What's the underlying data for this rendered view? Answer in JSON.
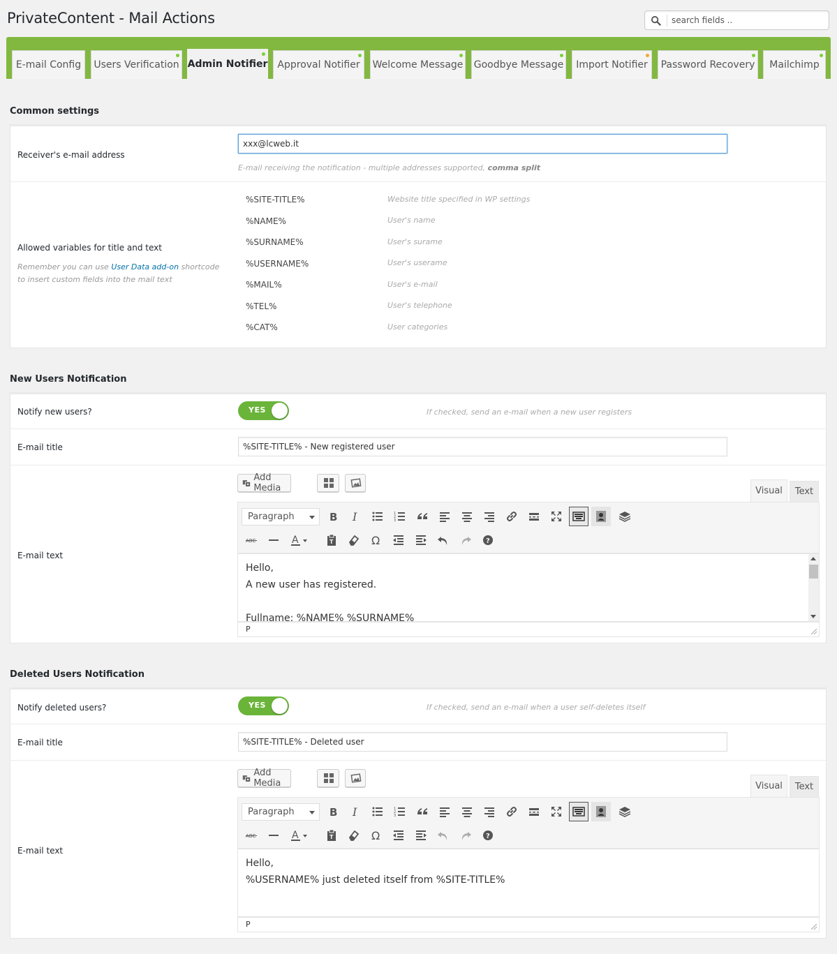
{
  "page": {
    "title": "PrivateContent - Mail Actions"
  },
  "search": {
    "placeholder": "search fields .."
  },
  "tabs": [
    {
      "label": "E-mail Config",
      "dot": ""
    },
    {
      "label": "Users Verification",
      "dot": "green"
    },
    {
      "label": "Admin Notifier",
      "dot": "green",
      "active": true
    },
    {
      "label": "Approval Notifier",
      "dot": "green"
    },
    {
      "label": "Welcome Message",
      "dot": "green"
    },
    {
      "label": "Goodbye Message",
      "dot": "green"
    },
    {
      "label": "Import Notifier",
      "dot": "orange"
    },
    {
      "label": "Password Recovery",
      "dot": "green"
    },
    {
      "label": "Mailchimp",
      "dot": "green"
    }
  ],
  "colors": {
    "accent_green": "#82b840",
    "toggle_green": "#6ab43a",
    "link_blue": "#0073aa",
    "dot_orange": "#f0a830"
  },
  "common": {
    "title": "Common settings",
    "receiver_label": "Receiver's e-mail address",
    "receiver_value": "xxx@lcweb.it",
    "receiver_hint": "E-mail receiving the notification - multiple addresses supported,",
    "receiver_hint_bold": "comma split",
    "vars_label": "Allowed variables for title and text",
    "vars_note_pre": "Remember you can use",
    "vars_note_link": "User Data add-on",
    "vars_note_post": "shortcode to insert custom fields into the mail text",
    "variables": [
      {
        "name": "%SITE-TITLE%",
        "desc": "Website title specified in WP settings"
      },
      {
        "name": "%NAME%",
        "desc": "User's name"
      },
      {
        "name": "%SURNAME%",
        "desc": "User's surame"
      },
      {
        "name": "%USERNAME%",
        "desc": "User's userame"
      },
      {
        "name": "%MAIL%",
        "desc": "User's e-mail"
      },
      {
        "name": "%TEL%",
        "desc": "User's telephone"
      },
      {
        "name": "%CAT%",
        "desc": "User categories"
      }
    ]
  },
  "new_users": {
    "title": "New Users Notification",
    "notify_label": "Notify new users?",
    "toggle": "YES",
    "notify_hint": "If checked, send an e-mail when a new user registers",
    "email_title_label": "E-mail title",
    "email_title_value": "%SITE-TITLE% - New registered user",
    "email_text_label": "E-mail text",
    "content": [
      "Hello,",
      "A new user has registered.",
      "",
      "Fullname: %NAME% %SURNAME%"
    ],
    "status": "P"
  },
  "deleted_users": {
    "title": "Deleted Users Notification",
    "notify_label": "Notify deleted users?",
    "toggle": "YES",
    "notify_hint": "If checked, send an e-mail when a user self-deletes itself",
    "email_title_label": "E-mail title",
    "email_title_value": "%SITE-TITLE% - Deleted user",
    "email_text_label": "E-mail text",
    "content": [
      "Hello,",
      "%USERNAME% just deleted itself from %SITE-TITLE%"
    ],
    "status": "P"
  },
  "editor": {
    "add_media": "Add Media",
    "visual_tab": "Visual",
    "text_tab": "Text",
    "format": "Paragraph"
  }
}
